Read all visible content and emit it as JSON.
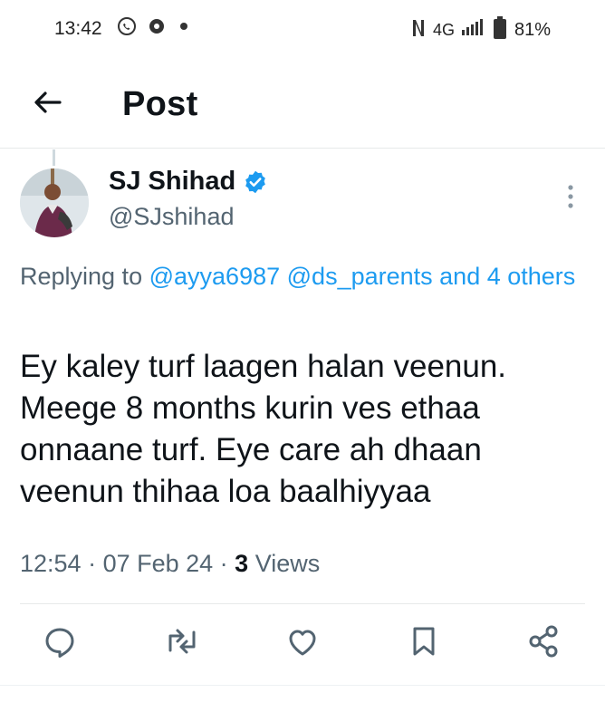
{
  "status_bar": {
    "time": "13:42",
    "network": "4G",
    "battery": "81%",
    "icons": [
      "viber-icon",
      "vpn-icon",
      "notification-dot-icon",
      "nfc-icon",
      "signal-icon",
      "battery-icon"
    ]
  },
  "header": {
    "title": "Post",
    "back_icon": "arrow-left-icon"
  },
  "tweet": {
    "author_name": "SJ Shihad",
    "author_handle": "@SJshihad",
    "verified": true,
    "replying_label": "Replying to",
    "replying_to": [
      "@ayya6987",
      "@ds_parents",
      "and 4 others"
    ],
    "body": "Ey kaley turf laagen halan veenun. Meege 8 months kurin ves ethaa onnaane turf. Eye care ah dhaan veenun thihaa loa baalhiyyaa",
    "time": "12:54",
    "separator": " · ",
    "date": "07 Feb 24",
    "views_count": "3",
    "views_label": " Views"
  },
  "actions": [
    "reply-icon",
    "retweet-icon",
    "like-icon",
    "bookmark-icon",
    "share-icon"
  ],
  "colors": {
    "accent": "#1d9bf0",
    "text": "#0f1419",
    "muted": "#536471",
    "icon": "#536471",
    "border": "#e7e9ea"
  }
}
